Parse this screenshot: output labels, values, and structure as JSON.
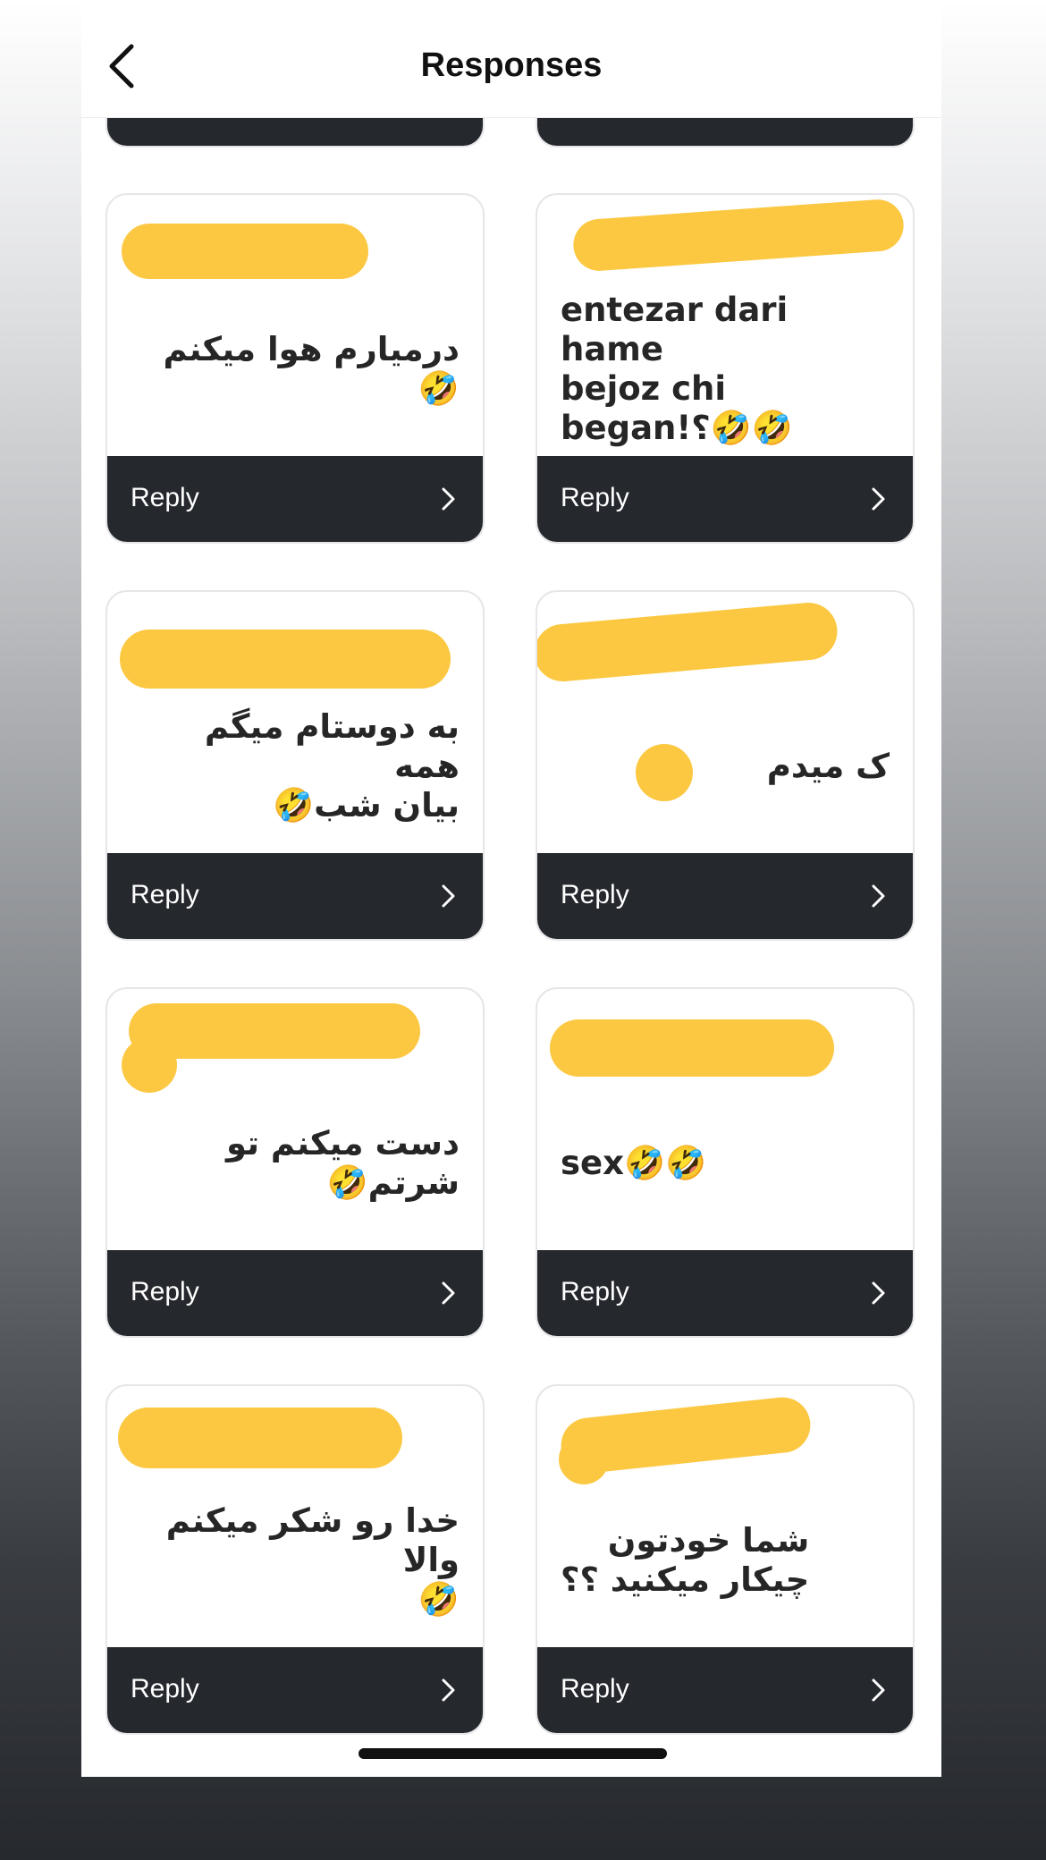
{
  "header": {
    "title": "Responses"
  },
  "reply_label": "Reply",
  "colors": {
    "redaction": "#fcc842",
    "reply_bar": "#25282d",
    "card_border": "#e6e6e8"
  },
  "icons": {
    "back": "chevron-left-icon",
    "reply_arrow": "chevron-right-icon",
    "emoji": "rolling-on-the-floor-laughing"
  },
  "cards": [
    {
      "message": ""
    },
    {
      "message": ""
    },
    {
      "message": "درمیارم هوا میکنم 🤣"
    },
    {
      "message": "entezar dari hame\nbejoz        chi\nbegan!؟🤣🤣"
    },
    {
      "message": "به دوستام میگم همه\nبیان شب🤣"
    },
    {
      "message": "ک     میدم"
    },
    {
      "message": "دست میکنم تو شرتم🤣"
    },
    {
      "message": "sex🤣🤣"
    },
    {
      "message": "خدا رو شکر میکنم والا\n🤣"
    },
    {
      "message": "شما خودتون\nچیکار میکنید ؟؟"
    }
  ]
}
